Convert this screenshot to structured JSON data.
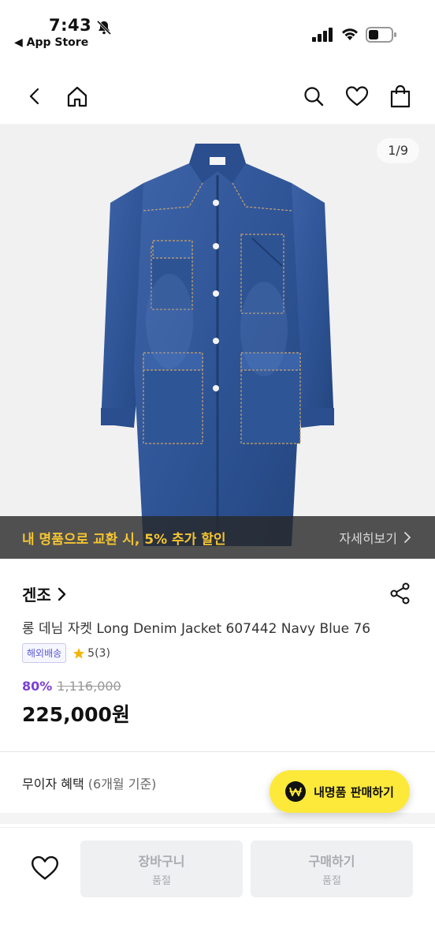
{
  "status": {
    "time": "7:43",
    "back_app": "◀ App Store"
  },
  "nav": {
    "icons": [
      "back-arrow-icon",
      "home-icon",
      "search-icon",
      "heart-icon",
      "shopping-bag-icon"
    ]
  },
  "gallery": {
    "counter": "1/9",
    "current_image": 1,
    "total_images": 9
  },
  "promo": {
    "text": "내 명품으로 교환 시, 5% 추가 할인",
    "link": "자세히보기"
  },
  "product": {
    "brand": "겐조",
    "name": "롱 데님 자켓 Long Denim Jacket 607442 Navy Blue 76",
    "shipping_badge": "해외배송",
    "rating": "5(3)",
    "discount": "80%",
    "original_price": "1,116,000",
    "final_price": "225,000원"
  },
  "installment": {
    "label": "무이자 혜택",
    "sub": "(6개월 기준)"
  },
  "sell_button": {
    "label": "내명품 판매하기"
  },
  "bottom_bar": {
    "cart_label": "장바구니",
    "cart_sub": "품절",
    "buy_label": "구매하기",
    "buy_sub": "품절"
  },
  "colors": {
    "promo_text": "#f4c430",
    "discount": "#7b3fd8",
    "sell_button": "#fde93a",
    "star": "#f4b400"
  }
}
